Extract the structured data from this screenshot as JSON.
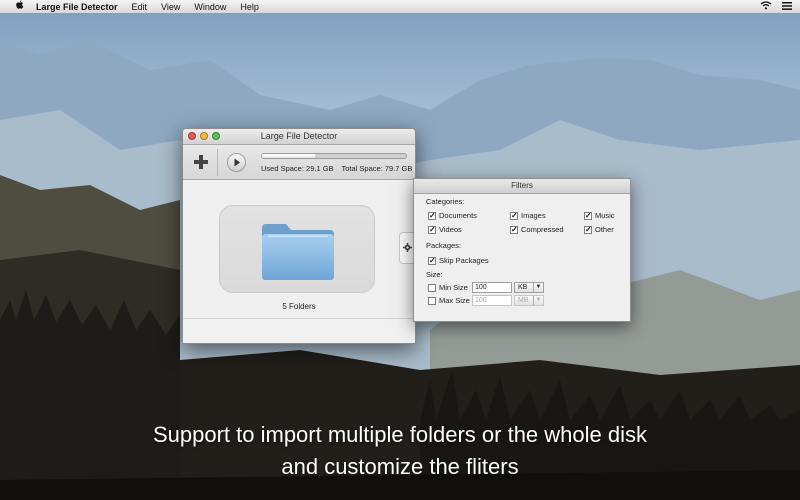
{
  "menubar": {
    "app_name": "Large File Detector",
    "items": [
      "Edit",
      "View",
      "Window",
      "Help"
    ],
    "icons": [
      "apple-icon",
      "wifi-icon",
      "list-icon"
    ]
  },
  "window": {
    "title": "Large File Detector",
    "progress_fraction": 0.37,
    "used_space": "Used Space: 29.1 GB",
    "total_space": "Total Space: 79.7 GB",
    "folder_count": "5 Folders",
    "icons": [
      "plus-icon",
      "play-icon",
      "folder-icon",
      "gear-icon"
    ]
  },
  "filters": {
    "title": "Filters",
    "categories_label": "Categories:",
    "categories": [
      {
        "label": "Documents",
        "checked": true
      },
      {
        "label": "Images",
        "checked": true
      },
      {
        "label": "Music",
        "checked": true
      },
      {
        "label": "Videos",
        "checked": true
      },
      {
        "label": "Compressed",
        "checked": true
      },
      {
        "label": "Other",
        "checked": true
      }
    ],
    "packages_label": "Packages:",
    "skip_packages": {
      "label": "Skip Packages",
      "checked": true
    },
    "size_label": "Size:",
    "min_size": {
      "label": "Min Size",
      "checked": false,
      "value": "100",
      "unit": "KB"
    },
    "max_size": {
      "label": "Max Size",
      "checked": false,
      "value": "100",
      "unit": "MB"
    }
  },
  "caption": {
    "line1": "Support to import multiple folders or the whole disk",
    "line2": "and customize the fliters"
  },
  "colors": {
    "close": "#ec5c54",
    "minimize": "#f2be3a",
    "zoom": "#58c34a",
    "folder": "#8cbde6"
  }
}
